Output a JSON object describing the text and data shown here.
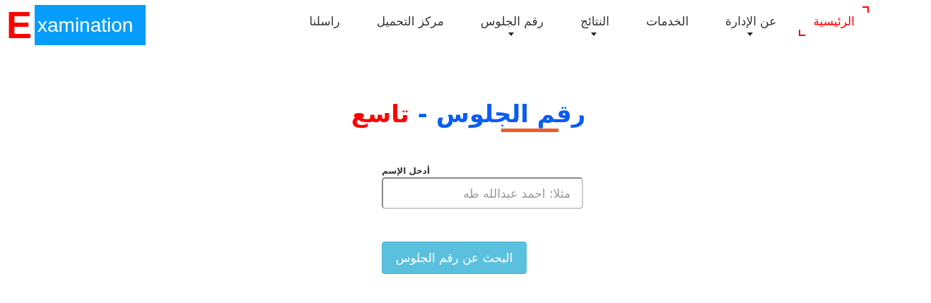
{
  "logo": {
    "initial": "E",
    "rest": "xamination"
  },
  "nav": [
    {
      "label": "الرئيسية",
      "selected": true,
      "dropdown": false
    },
    {
      "label": "عن الإدارة",
      "selected": false,
      "dropdown": true
    },
    {
      "label": "الخدمات",
      "selected": false,
      "dropdown": false
    },
    {
      "label": "النتائج",
      "selected": false,
      "dropdown": true
    },
    {
      "label": "رقم الجلوس",
      "selected": false,
      "dropdown": true
    },
    {
      "label": "مركز التحميل",
      "selected": false,
      "dropdown": false
    },
    {
      "label": "راسلنا",
      "selected": false,
      "dropdown": false
    }
  ],
  "title": {
    "main": "رقم الجلوس",
    "separator": "-",
    "grade": "تاسع"
  },
  "form": {
    "label": "أدخل الإسم",
    "placeholder": "مثلا: احمد عبدالله طه",
    "button": "البحث عن رقم الجلوس"
  }
}
